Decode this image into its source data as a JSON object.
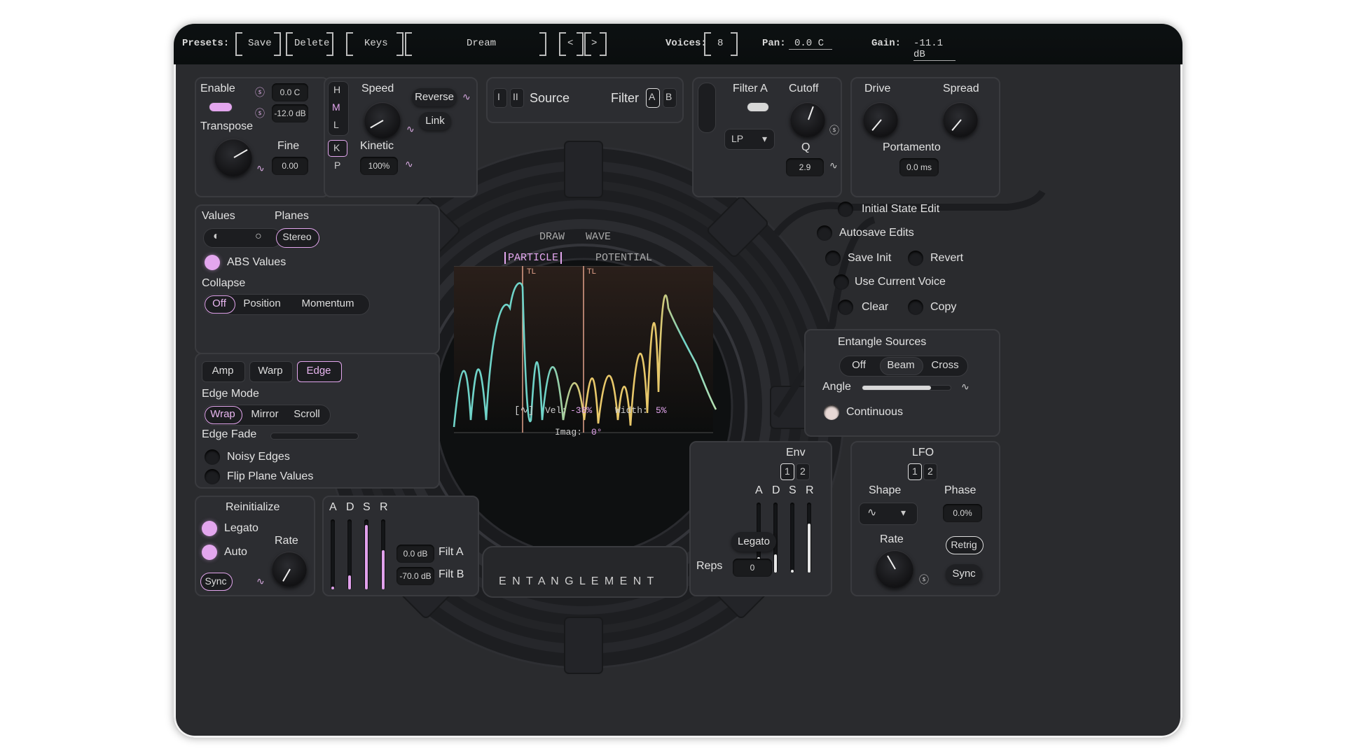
{
  "topbar": {
    "presets_label": "Presets:",
    "save_label": "Save",
    "delete_label": "Delete",
    "keys_label": "Keys",
    "preset_name": "Dream",
    "prev_label": "<",
    "next_label": ">",
    "voices_label": "Voices:",
    "voices_value": "8",
    "pan_label": "Pan:",
    "pan_value": "0.0 C",
    "gain_label": "Gain:",
    "gain_value": "-11.1 dB"
  },
  "osc": {
    "enable_label": "Enable",
    "pan_value": "0.0 C",
    "gain_value": "-12.0 dB",
    "transpose_label": "Transpose",
    "fine_label": "Fine",
    "fine_value": "0.00",
    "h": "H",
    "m": "M",
    "l": "L",
    "k": "K",
    "p": "P",
    "speed_label": "Speed",
    "reverse_label": "Reverse",
    "link_label": "Link",
    "kinetic_label": "Kinetic",
    "kinetic_value": "100%"
  },
  "source": {
    "i": "I",
    "ii": "II",
    "source_label": "Source",
    "filter_label": "Filter",
    "a": "A",
    "b": "B"
  },
  "filter": {
    "filter_a_label": "Filter A",
    "cutoff_label": "Cutoff",
    "type_value": "LP",
    "q_label": "Q",
    "q_value": "2.9"
  },
  "drive": {
    "drive_label": "Drive",
    "spread_label": "Spread",
    "portamento_label": "Portamento",
    "portamento_value": "0.0 ms"
  },
  "values": {
    "values_label": "Values",
    "planes_label": "Planes",
    "stereo_label": "Stereo",
    "abs_label": "ABS Values",
    "collapse_label": "Collapse",
    "collapse_options": [
      "Off",
      "Position",
      "Momentum"
    ]
  },
  "edge": {
    "tabs": [
      "Amp",
      "Warp",
      "Edge"
    ],
    "edge_mode_label": "Edge Mode",
    "edge_mode_options": [
      "Wrap",
      "Mirror",
      "Scroll"
    ],
    "edge_fade_label": "Edge Fade",
    "noisy_label": "Noisy Edges",
    "flip_label": "Flip Plane Values"
  },
  "display": {
    "draw": "DRAW",
    "wave": "WAVE",
    "particle": "PARTICLE",
    "potential": "POTENTIAL",
    "tl1": "TL",
    "tl2": "TL",
    "vel_label": "Vel:",
    "vel_value": "-38%",
    "width_label": "Width:",
    "width_value": "5%",
    "imag_label": "Imag:",
    "imag_value": "0°",
    "brand": "E N T A N G L E M E N T"
  },
  "state": {
    "initial_label": "Initial State Edit",
    "autosave_label": "Autosave Edits",
    "save_init_label": "Save Init",
    "revert_label": "Revert",
    "use_voice_label": "Use Current Voice",
    "clear_label": "Clear",
    "copy_label": "Copy"
  },
  "entangle": {
    "title": "Entangle Sources",
    "options": [
      "Off",
      "Beam",
      "Cross"
    ],
    "angle_label": "Angle",
    "angle_level": 0.78,
    "continuous_label": "Continuous"
  },
  "reinit": {
    "title": "Reinitialize",
    "legato_label": "Legato",
    "auto_label": "Auto",
    "rate_label": "Rate",
    "sync_label": "Sync"
  },
  "adsr_left": {
    "a": "A",
    "d": "D",
    "s": "S",
    "r": "R",
    "filt_a_value": "0.0 dB",
    "filt_a_label": "Filt A",
    "filt_b_value": "-70.0 dB",
    "filt_b_label": "Filt B"
  },
  "env": {
    "title": "Env",
    "one": "1",
    "two": "2",
    "a": "A",
    "d": "D",
    "s": "S",
    "r": "R",
    "legato_label": "Legato",
    "reps_label": "Reps",
    "reps_value": "0"
  },
  "lfo": {
    "title": "LFO",
    "one": "1",
    "two": "2",
    "shape_label": "Shape",
    "phase_label": "Phase",
    "phase_value": "0.0%",
    "rate_label": "Rate",
    "retrig_label": "Retrig",
    "sync_label": "Sync"
  },
  "colors": {
    "accent": "#e3a6ee",
    "background": "#2a2b2e",
    "teal": "#6fd3c8",
    "yellow": "#e8c86a"
  }
}
